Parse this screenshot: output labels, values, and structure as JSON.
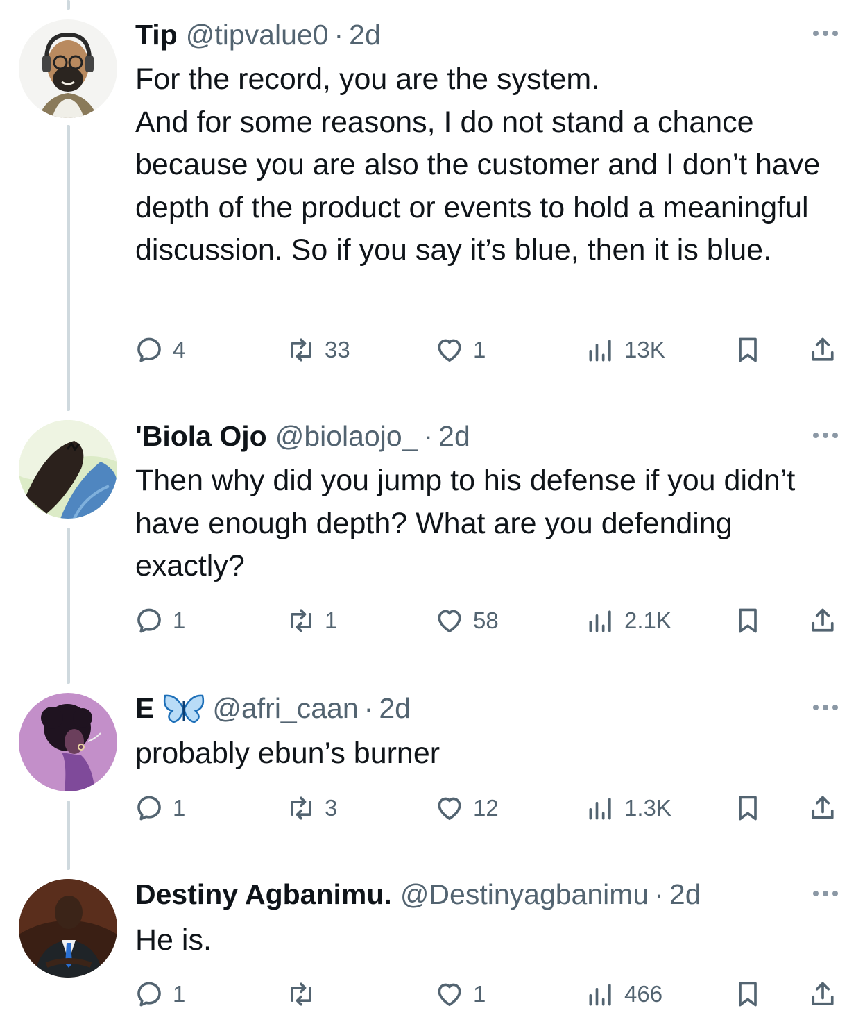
{
  "tweets": [
    {
      "name": "Tip",
      "handle": "@tipvalue0",
      "time": "2d",
      "text_lines": [
        "For the record, you are the system.",
        "And for some reasons, I do not stand a chance because you are also the customer and I don’t have depth of the product or events to hold a meaningful discussion. So if you say it’s blue, then it is blue."
      ],
      "replies": "4",
      "retweets": "33",
      "likes": "1",
      "views": "13K"
    },
    {
      "name": "'Biola Ojo",
      "handle": "@biolaojo_",
      "time": "2d",
      "text_lines": [
        "Then why did you jump to his defense if you didn’t have enough depth? What are you defending exactly?"
      ],
      "replies": "1",
      "retweets": "1",
      "likes": "58",
      "views": "2.1K"
    },
    {
      "name": "E",
      "badge_icon": "butterfly-icon",
      "handle": "@afri_caan",
      "time": "2d",
      "text_lines": [
        "probably ebun’s burner"
      ],
      "replies": "1",
      "retweets": "3",
      "likes": "12",
      "views": "1.3K"
    },
    {
      "name": "Destiny Agbanimu.",
      "handle": "@Destinyagbanimu",
      "time": "2d",
      "text_lines": [
        "He is."
      ],
      "replies": "1",
      "retweets": "",
      "likes": "1",
      "views": "466"
    }
  ],
  "separator": "·",
  "icons": {
    "reply": "reply-icon",
    "retweet": "retweet-icon",
    "like": "heart-icon",
    "views": "views-icon",
    "bookmark": "bookmark-icon",
    "share": "share-icon",
    "more": "more-icon"
  },
  "colors": {
    "text": "#0f1419",
    "muted": "#536471",
    "thread_line": "#cfd9de",
    "butterfly": "#1d9bf0"
  }
}
